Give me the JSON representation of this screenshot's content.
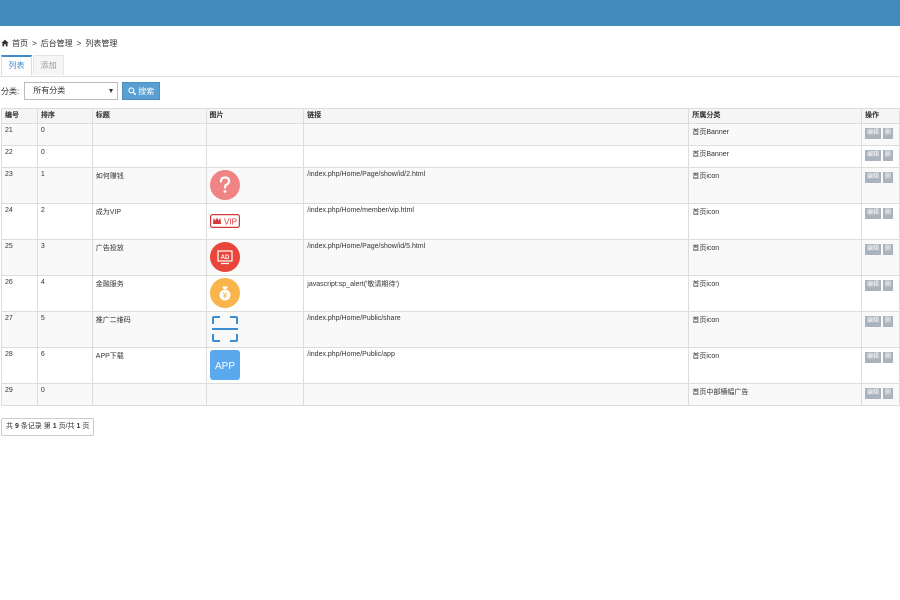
{
  "breadcrumb": {
    "home": "首页",
    "sep1": ">",
    "section": "后台管理",
    "sep2": ">",
    "current": "列表管理"
  },
  "tabs": [
    {
      "label": "列表"
    },
    {
      "label": "添加"
    }
  ],
  "filter": {
    "label": "分类:",
    "selected": "所有分类",
    "search_label": "搜索"
  },
  "table": {
    "headers": [
      "编号",
      "排序",
      "标题",
      "图片",
      "链接",
      "所属分类",
      "操作"
    ],
    "rows": [
      {
        "id": "21",
        "sort": "0",
        "title": "",
        "image": "",
        "link": "",
        "category": "首页Banner"
      },
      {
        "id": "22",
        "sort": "0",
        "title": "",
        "image": "",
        "link": "",
        "category": "首页Banner"
      },
      {
        "id": "23",
        "sort": "1",
        "title": "如何赚钱",
        "image": "question-icon",
        "link": "/index.php/Home/Page/show/id/2.html",
        "category": "首页icon"
      },
      {
        "id": "24",
        "sort": "2",
        "title": "成为VIP",
        "image": "vip-icon",
        "link": "/index.php/Home/member/vip.html",
        "category": "首页icon"
      },
      {
        "id": "25",
        "sort": "3",
        "title": "广告投放",
        "image": "ad-icon",
        "link": "/index.php/Home/Page/show/id/5.html",
        "category": "首页icon"
      },
      {
        "id": "26",
        "sort": "4",
        "title": "金融服务",
        "image": "money-bag-icon",
        "link": "javascript:sp_alert('敬请期待')",
        "category": "首页icon"
      },
      {
        "id": "27",
        "sort": "5",
        "title": "推广二维码",
        "image": "scan-qr-icon",
        "link": "/index.php/Home/Public/share",
        "category": "首页icon"
      },
      {
        "id": "28",
        "sort": "6",
        "title": "APP下载",
        "image": "app-icon",
        "link": "/index.php/Home/Public/app",
        "category": "首页icon"
      },
      {
        "id": "29",
        "sort": "0",
        "title": "",
        "image": "",
        "link": "",
        "category": "首页中部横幅广告"
      }
    ],
    "actions": {
      "edit": "编辑",
      "delete": "删"
    }
  },
  "icon_text": {
    "vip": "VIP",
    "ad": "AD",
    "app": "APP"
  },
  "pager": {
    "pre": "共",
    "count": "9",
    "mid": "条记录 第",
    "page": "1",
    "sep": "页/共",
    "total": "1",
    "post": "页"
  },
  "colors": {
    "topbar": "#428bba",
    "accent": "#428bca",
    "search_btn": "#5a9fd2",
    "op_btn": "#a8b3bd"
  }
}
